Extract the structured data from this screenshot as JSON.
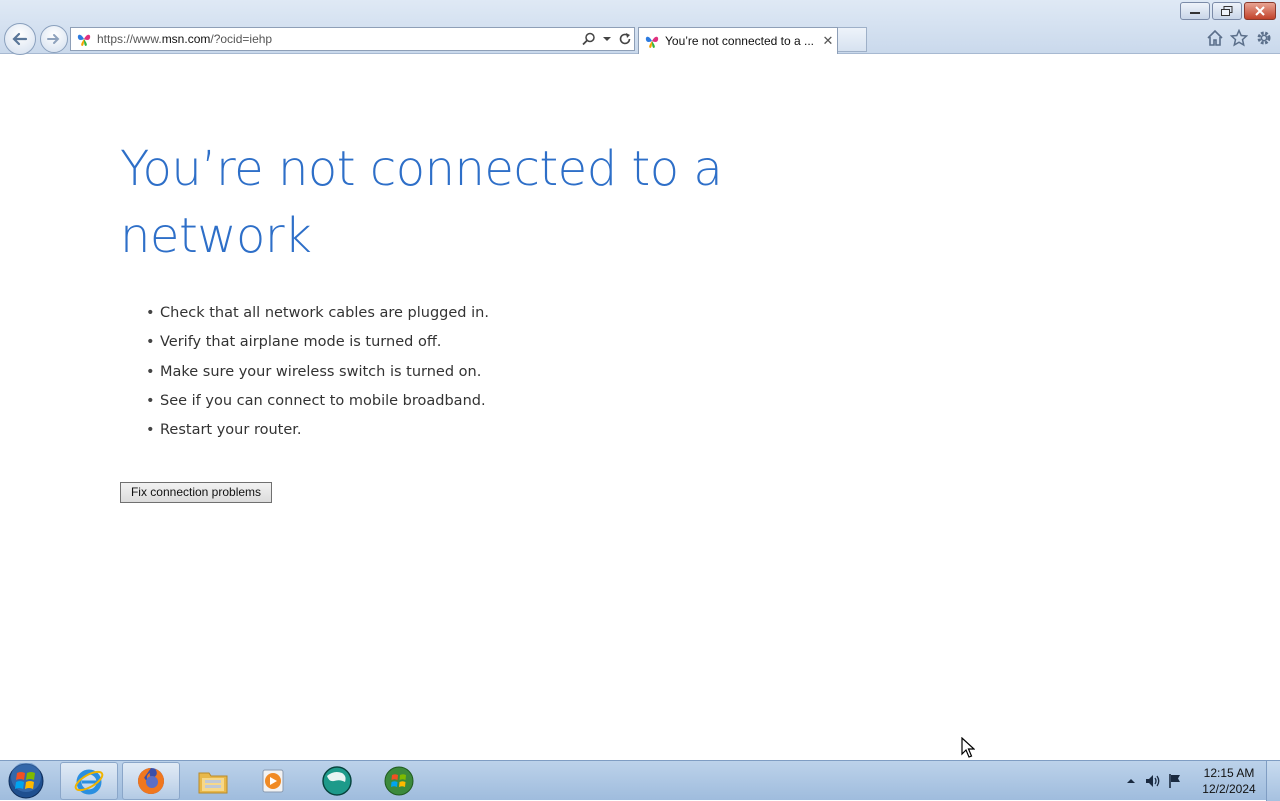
{
  "browser": {
    "address": {
      "url_prefix": "https://www.",
      "url_domain": "msn.com",
      "url_suffix": "/?ocid=iehp"
    },
    "tab": {
      "title": "You’re not connected to a ..."
    },
    "icons": [
      "back-arrow-icon",
      "forward-arrow-icon",
      "msn-butterfly-icon",
      "search-icon",
      "refresh-icon",
      "home-icon",
      "favorites-star-icon",
      "tools-gear-icon"
    ]
  },
  "page": {
    "title": "You’re not connected to a network",
    "tips": [
      "Check that all network cables are plugged in.",
      "Verify that airplane mode is turned off.",
      "Make sure your wireless switch is turned on.",
      "See if you can connect to mobile broadband.",
      "Restart your router."
    ],
    "fix_button": "Fix connection problems"
  },
  "taskbar": {
    "items": [
      "internet-explorer",
      "firefox",
      "file-explorer",
      "media-player",
      "app-globe",
      "windows-update"
    ],
    "clock": {
      "time": "12:15 AM",
      "date": "12/2/2024"
    }
  },
  "colors": {
    "title": "#2e6fc8",
    "taskbar": "#a9c4e4"
  }
}
